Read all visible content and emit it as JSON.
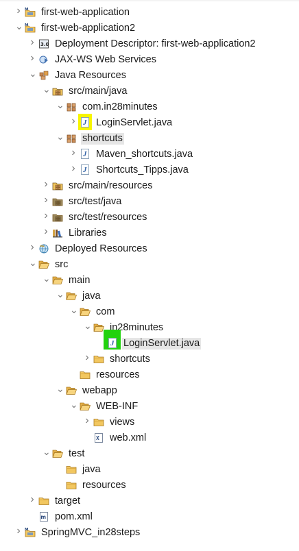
{
  "tree": {
    "rows": [
      {
        "label": "first-web-application",
        "toggle": "collapsed",
        "icon": "web-project-icon",
        "depth": 0
      },
      {
        "label": "first-web-application2",
        "toggle": "expanded",
        "icon": "web-project-icon",
        "depth": 0
      },
      {
        "label": "Deployment Descriptor: first-web-application2",
        "toggle": "collapsed",
        "icon": "deployment-descriptor-icon",
        "depth": 1
      },
      {
        "label": "JAX-WS Web Services",
        "toggle": "collapsed",
        "icon": "web-services-icon",
        "depth": 1
      },
      {
        "label": "Java Resources",
        "toggle": "expanded",
        "icon": "java-resources-icon",
        "depth": 1
      },
      {
        "label": "src/main/java",
        "toggle": "expanded",
        "icon": "source-folder-icon",
        "depth": 2
      },
      {
        "label": "com.in28minutes",
        "toggle": "expanded",
        "icon": "package-icon",
        "depth": 3
      },
      {
        "label": "LoginServlet.java",
        "toggle": "collapsed",
        "icon": "java-file-icon",
        "depth": 4,
        "highlight": "yellow"
      },
      {
        "label": "shortcuts",
        "toggle": "expanded",
        "icon": "package-icon",
        "depth": 3,
        "selected": true
      },
      {
        "label": "Maven_shortcuts.java",
        "toggle": "collapsed",
        "icon": "java-file-icon",
        "depth": 4
      },
      {
        "label": "Shortcuts_Tipps.java",
        "toggle": "collapsed",
        "icon": "java-file-icon",
        "depth": 4
      },
      {
        "label": "src/main/resources",
        "toggle": "collapsed",
        "icon": "source-folder-icon",
        "depth": 2
      },
      {
        "label": "src/test/java",
        "toggle": "collapsed",
        "icon": "test-source-folder-icon",
        "depth": 2
      },
      {
        "label": "src/test/resources",
        "toggle": "collapsed",
        "icon": "test-source-folder-icon",
        "depth": 2
      },
      {
        "label": "Libraries",
        "toggle": "collapsed",
        "icon": "libraries-icon",
        "depth": 2
      },
      {
        "label": "Deployed Resources",
        "toggle": "collapsed",
        "icon": "deployed-resources-icon",
        "depth": 1
      },
      {
        "label": "src",
        "toggle": "expanded",
        "icon": "folder-open-icon",
        "depth": 1
      },
      {
        "label": "main",
        "toggle": "expanded",
        "icon": "folder-open-icon",
        "depth": 2
      },
      {
        "label": "java",
        "toggle": "expanded",
        "icon": "folder-open-icon",
        "depth": 3
      },
      {
        "label": "com",
        "toggle": "expanded",
        "icon": "folder-open-icon",
        "depth": 4
      },
      {
        "label": "in28minutes",
        "toggle": "expanded",
        "icon": "folder-open-icon",
        "depth": 5
      },
      {
        "label": "LoginServlet.java",
        "toggle": "none",
        "icon": "java-file-icon",
        "depth": 6,
        "highlight": "green",
        "selected": true
      },
      {
        "label": "shortcuts",
        "toggle": "collapsed",
        "icon": "folder-icon",
        "depth": 5
      },
      {
        "label": "resources",
        "toggle": "none",
        "icon": "folder-icon",
        "depth": 4
      },
      {
        "label": "webapp",
        "toggle": "expanded",
        "icon": "folder-open-icon",
        "depth": 3
      },
      {
        "label": "WEB-INF",
        "toggle": "expanded",
        "icon": "folder-open-icon",
        "depth": 4
      },
      {
        "label": "views",
        "toggle": "collapsed",
        "icon": "folder-icon",
        "depth": 5
      },
      {
        "label": "web.xml",
        "toggle": "none",
        "icon": "xml-file-icon",
        "depth": 5
      },
      {
        "label": "test",
        "toggle": "expanded",
        "icon": "folder-open-icon",
        "depth": 2
      },
      {
        "label": "java",
        "toggle": "none",
        "icon": "folder-icon",
        "depth": 3
      },
      {
        "label": "resources",
        "toggle": "none",
        "icon": "folder-icon",
        "depth": 3
      },
      {
        "label": "target",
        "toggle": "collapsed",
        "icon": "folder-icon",
        "depth": 1
      },
      {
        "label": "pom.xml",
        "toggle": "none",
        "icon": "maven-pom-icon",
        "depth": 1
      },
      {
        "label": "SpringMVC_in28steps",
        "toggle": "collapsed",
        "icon": "web-project-icon",
        "depth": 0
      }
    ]
  }
}
